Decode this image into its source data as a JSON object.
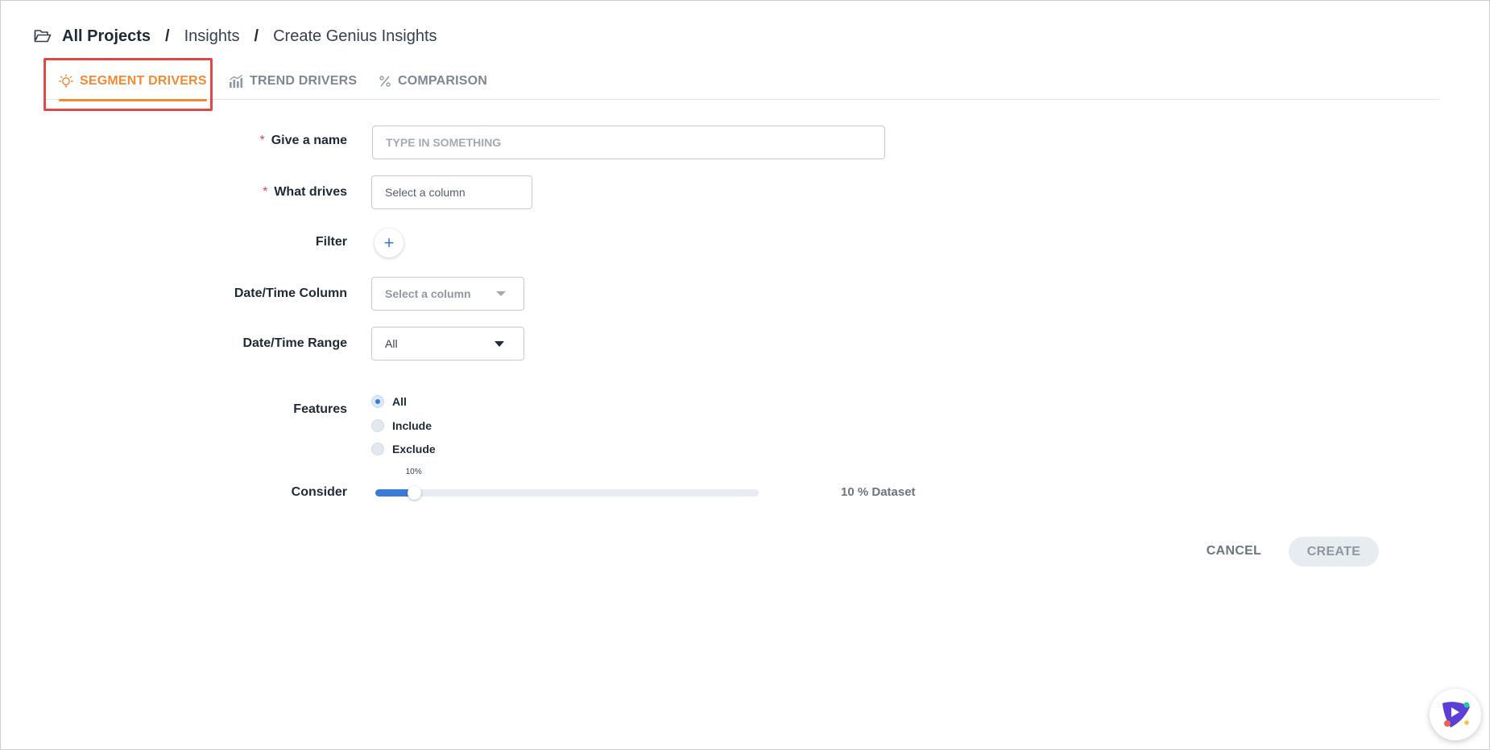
{
  "breadcrumb": {
    "root": "All Projects",
    "separator": "/",
    "items": [
      "Insights",
      "Create Genius Insights"
    ]
  },
  "tabs": [
    {
      "label": "SEGMENT DRIVERS",
      "active": true,
      "icon": "lightbulb-icon"
    },
    {
      "label": "TREND DRIVERS",
      "active": false,
      "icon": "bar-trend-icon"
    },
    {
      "label": "COMPARISON",
      "active": false,
      "icon": "percent-icon"
    }
  ],
  "form": {
    "name": {
      "label": "Give a name",
      "required_mark": "*",
      "placeholder": "TYPE IN SOMETHING",
      "value": ""
    },
    "what_drives": {
      "label": "What drives",
      "required_mark": "*",
      "value": "Select a column"
    },
    "filter": {
      "label": "Filter",
      "add_symbol": "+"
    },
    "datetime_column": {
      "label": "Date/Time Column",
      "value": "Select a column"
    },
    "datetime_range": {
      "label": "Date/Time Range",
      "value": "All"
    },
    "features": {
      "label": "Features",
      "options": [
        "All",
        "Include",
        "Exclude"
      ],
      "selected": "All"
    },
    "consider": {
      "label": "Consider",
      "tooltip": "10%",
      "value_percent": 10,
      "summary": "10 % Dataset"
    }
  },
  "actions": {
    "cancel": "CANCEL",
    "create": "CREATE"
  },
  "colors": {
    "accent": "#f08a36",
    "primary": "#3b7bd8",
    "highlight": "#e04848",
    "muted": "#7d8793"
  }
}
